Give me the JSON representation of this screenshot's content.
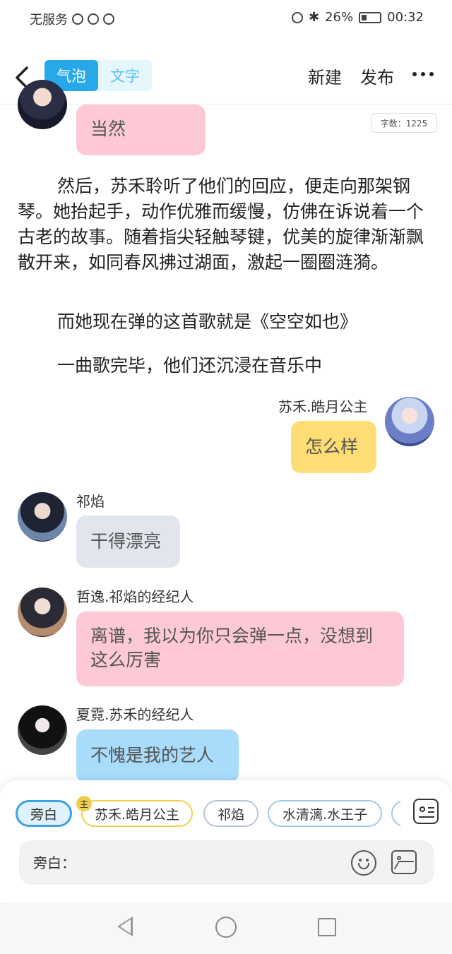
{
  "status": {
    "carrier": "无服务",
    "battery": "26%",
    "time": "00:32"
  },
  "header": {
    "tab_bubble": "气泡",
    "tab_text": "文字",
    "new": "新建",
    "publish": "发布"
  },
  "word_count": "字数：1225",
  "messages": {
    "m1": {
      "text": "当然"
    },
    "n1": "然后，苏禾聆听了他们的回应，便走向那架钢琴。她抬起手，动作优雅而缓慢，仿佛在诉说着一个古老的故事。随着指尖轻触琴键，优美的旋律渐渐飘散开来，如同春风拂过湖面，激起一圈圈涟漪。",
    "n2": "而她现在弹的这首歌就是《空空如也》",
    "n3": "一曲歌完毕，他们还沉浸在音乐中",
    "m2": {
      "name": "苏禾.皓月公主",
      "text": "怎么样"
    },
    "m3": {
      "name": "祁焰",
      "text": "干得漂亮"
    },
    "m4": {
      "name": "哲逸.祁焰的经纪人",
      "text": "离谱，我以为你只会弹一点，没想到这么厉害"
    },
    "m5": {
      "name": "夏霓.苏禾的经纪人",
      "text": "不愧是我的艺人"
    }
  },
  "chips": {
    "narrator": "旁白",
    "main_badge": "主",
    "c1": "苏禾.皓月公主",
    "c2": "祁焰",
    "c3": "水清漓.水王子"
  },
  "input": {
    "placeholder": "旁白："
  }
}
